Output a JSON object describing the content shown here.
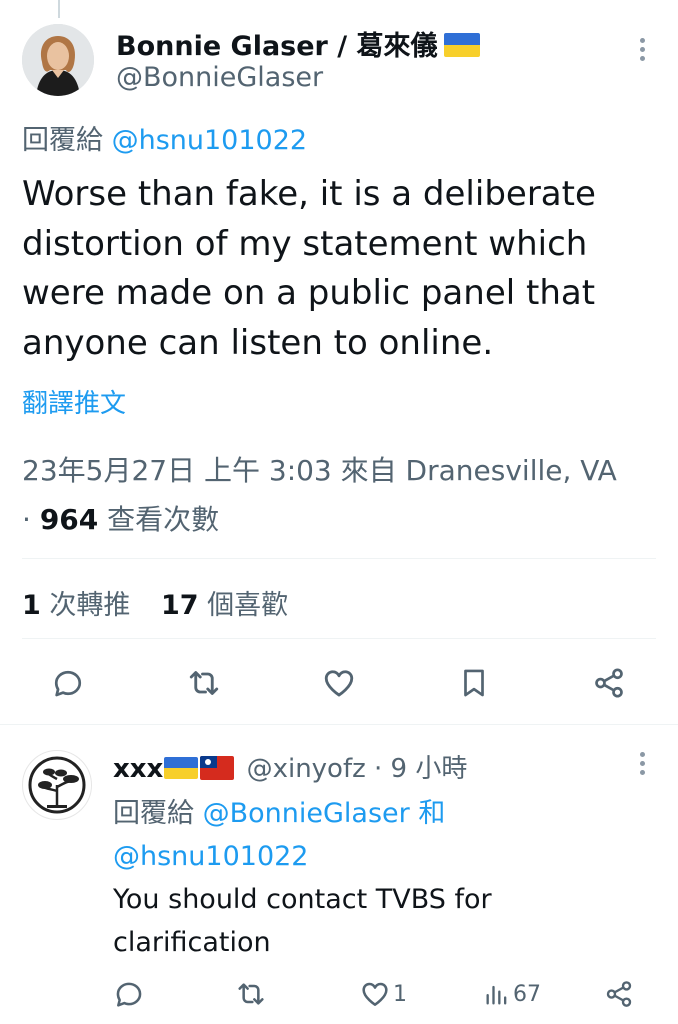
{
  "tweet": {
    "author_name": "Bonnie Glaser / 葛來儀",
    "handle": "@BonnieGlaser",
    "reply_prefix": "回覆給",
    "reply_to": "@hsnu101022",
    "text": "Worse than fake, it is a deliberate distortion of my statement which were made on a public panel that anyone can listen to online.",
    "translate_label": "翻譯推文",
    "timestamp": "23年5月27日 上午 3:03 來自 Dranesville, VA",
    "views_dot": "·",
    "views_count": "964",
    "views_label": "查看次數",
    "retweets_count": "1",
    "retweets_label": "次轉推",
    "likes_count": "17",
    "likes_label": "個喜歡"
  },
  "reply": {
    "author_name": "xxx",
    "handle": "@xinyofz",
    "time": "· 9 小時",
    "reply_prefix": "回覆給",
    "mention1": "@BonnieGlaser",
    "conjunction": "和",
    "mention2": "@hsnu101022",
    "text": "You should contact TVBS for clarification",
    "like_count": "1",
    "views_count": "67"
  },
  "icons": {
    "reply": "reply-icon",
    "retweet": "retweet-icon",
    "like": "heart-icon",
    "bookmark": "bookmark-icon",
    "share": "share-icon",
    "views": "views-chart-icon",
    "more": "more-vertical-icon"
  },
  "colors": {
    "link": "#1d9bf0",
    "muted": "#536471",
    "text": "#0f1419",
    "divider": "#eff3f4"
  }
}
